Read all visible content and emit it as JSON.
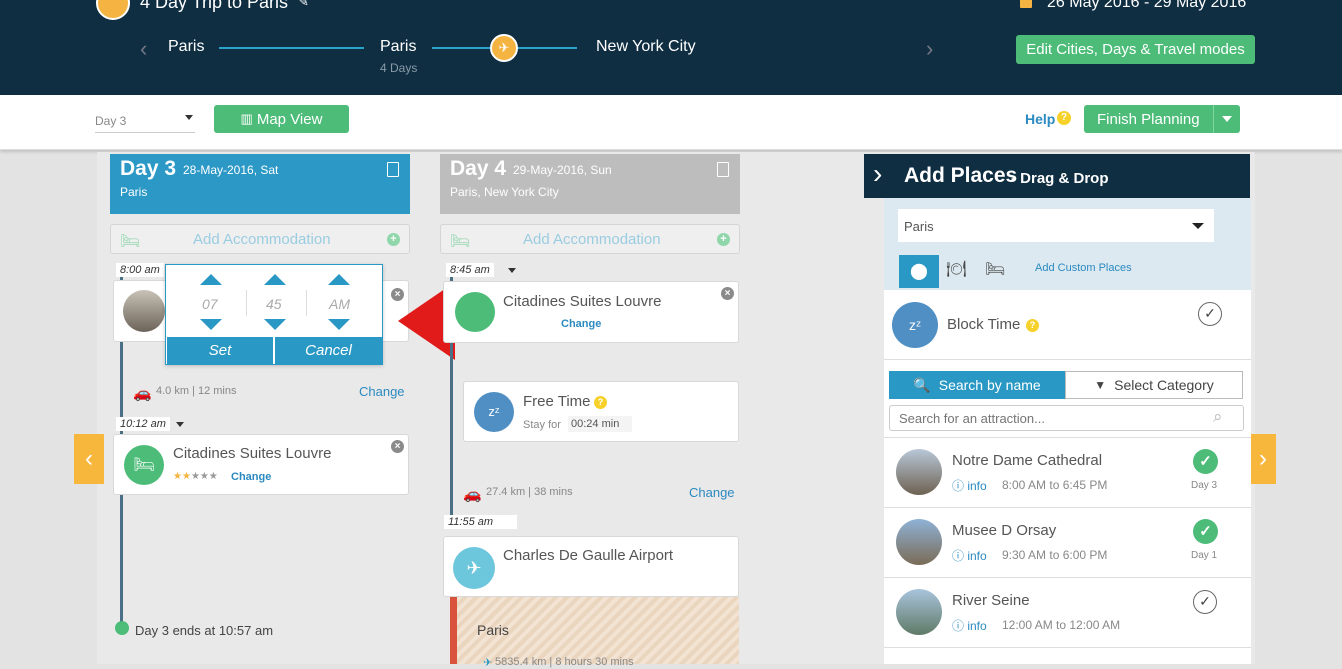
{
  "header": {
    "trip_title": "4 Day Trip to Paris",
    "dates": "26 May 2016 - 29 May 2016",
    "route": [
      {
        "name": "Paris",
        "sub": ""
      },
      {
        "name": "Paris",
        "sub": "4 Days"
      },
      {
        "name": "New York City",
        "sub": ""
      }
    ],
    "edit_button": "Edit Cities, Days & Travel modes"
  },
  "toolbar": {
    "day_select": "Day 3",
    "map_view": "Map View",
    "help": "Help",
    "finish": "Finish Planning"
  },
  "day3": {
    "title": "Day 3",
    "date": "28-May-2016, Sat",
    "city": "Paris",
    "add_accommodation": "Add Accommodation",
    "time1": "8:00 am",
    "travel1": "4.0 km | 12 mins",
    "change": "Change",
    "time2": "10:12 am",
    "hotel": "Citadines Suites Louvre",
    "hotel_change": "Change",
    "end_text": "Day 3 ends at 10:57 am"
  },
  "time_picker": {
    "hour": "07",
    "minute": "45",
    "ampm": "AM",
    "set": "Set",
    "cancel": "Cancel"
  },
  "day4": {
    "title": "Day 4",
    "date": "29-May-2016, Sun",
    "city": "Paris, New York City",
    "add_accommodation": "Add Accommodation",
    "time1": "8:45 am",
    "hotel": "Citadines Suites Louvre",
    "hotel_change": "Change",
    "free_time": "Free Time",
    "stay_for": "Stay for",
    "stay_value": "00:24 min",
    "travel": "27.4 km | 38 mins",
    "change": "Change",
    "time2": "11:55 am",
    "airport": "Charles De Gaulle Airport",
    "city_band": "Paris",
    "flight": "5835.4 km | 8 hours 30 mins"
  },
  "panel": {
    "title": "Add Places",
    "subtitle": "- Drag & Drop",
    "city_select": "Paris",
    "add_custom": "Add Custom Places",
    "block_time": "Block Time",
    "search_by_name": "Search by name",
    "select_category": "Select Category",
    "search_placeholder": "Search for an attraction...",
    "places": [
      {
        "name": "Notre Dame Cathedral",
        "info": "info",
        "hours": "8:00 AM to 6:45 PM",
        "day": "Day 3"
      },
      {
        "name": "Musee D Orsay",
        "info": "info",
        "hours": "9:30 AM to 6:00 PM",
        "day": "Day 1"
      },
      {
        "name": "River Seine",
        "info": "info",
        "hours": "12:00 AM to 12:00 AM",
        "day": ""
      }
    ]
  },
  "colors": {
    "navy": "#0f2e42",
    "green": "#4cbc78",
    "day_active": "#2b98c5",
    "day_inactive": "#bdbdbd",
    "arrow": "#e11a1a",
    "nav_orange": "#f6b73c"
  }
}
